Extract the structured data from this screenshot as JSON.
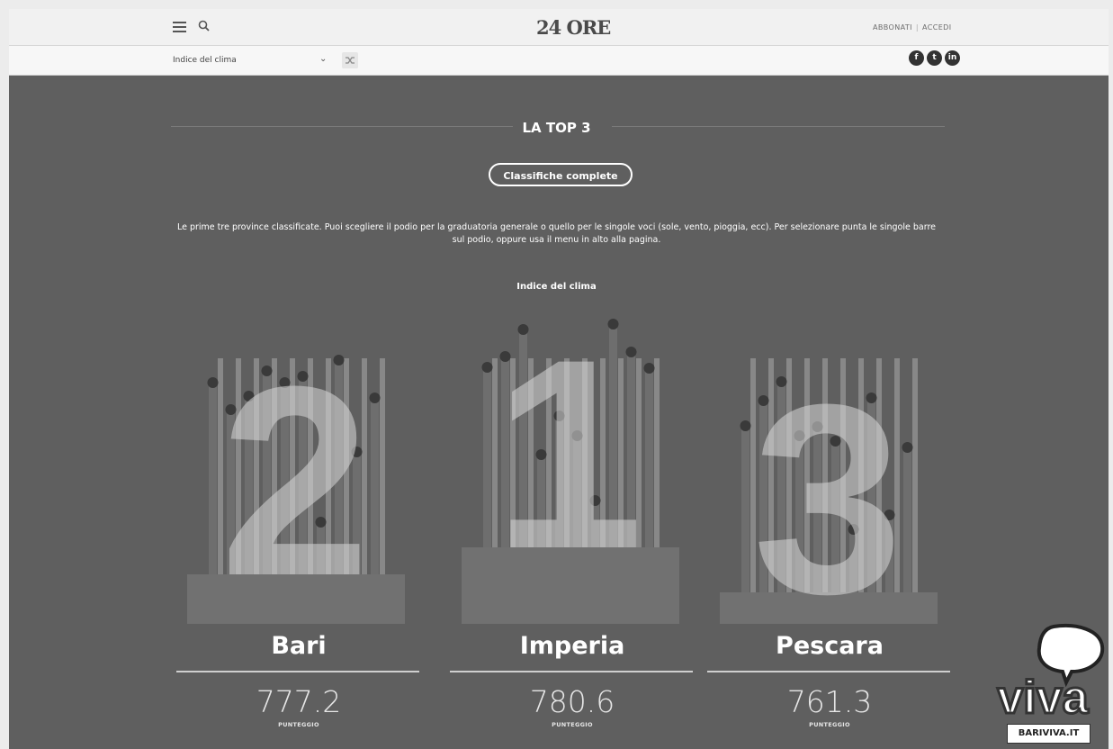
{
  "header": {
    "logo": "24 ORE",
    "subscribe": "ABBONATI",
    "login": "ACCEDI"
  },
  "subbar": {
    "selected_index": "Indice del clima"
  },
  "social": [
    "facebook-icon",
    "twitter-icon",
    "linkedin-icon"
  ],
  "main": {
    "title": "LA TOP 3",
    "button": "Classifiche complete",
    "description": "Le prime tre province classificate. Puoi scegliere il podio per la graduatoria generale o quello per le singole voci (sole, vento, pioggia, ecc). Per selezionare punta le singole barre sul podio, oppure usa il menu in alto alla pagina.",
    "chart_title": "Indice del clima"
  },
  "podium": [
    {
      "rank": "2",
      "city": "Bari",
      "score": "777.2",
      "score_label": "PUNTEGGIO"
    },
    {
      "rank": "1",
      "city": "Imperia",
      "score": "780.6",
      "score_label": "PUNTEGGIO"
    },
    {
      "rank": "3",
      "city": "Pescara",
      "score": "761.3",
      "score_label": "PUNTEGGIO"
    }
  ],
  "watermark": {
    "logo_text": "viva",
    "site": "BARIVIVA.IT"
  },
  "colors": {
    "background": "#5f5f5f",
    "bar": "#d6d6d6",
    "pillar": "#6e6e6e",
    "dot": "#3a3a3a"
  }
}
